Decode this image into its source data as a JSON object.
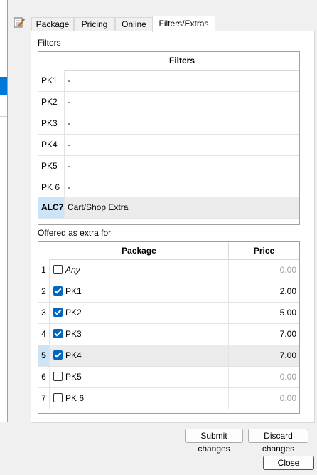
{
  "tabs": [
    "Package",
    "Pricing",
    "Online",
    "Filters/Extras"
  ],
  "active_tab": "Filters/Extras",
  "filters_section_label": "Filters",
  "filters_table": {
    "header": "Filters",
    "rows": [
      {
        "key": "PK1",
        "value": "-"
      },
      {
        "key": "PK2",
        "value": "-"
      },
      {
        "key": "PK3",
        "value": "-"
      },
      {
        "key": "PK4",
        "value": "-"
      },
      {
        "key": "PK5",
        "value": "-"
      },
      {
        "key": "PK 6",
        "value": "-"
      },
      {
        "key": "ALC7",
        "value": "Cart/Shop Extra"
      }
    ]
  },
  "offered_section_label": "Offered as extra for",
  "package_table": {
    "header_package": "Package",
    "header_price": "Price",
    "rows": [
      {
        "num": "1",
        "name": "Any",
        "checked": false,
        "price": "0.00"
      },
      {
        "num": "2",
        "name": "PK1",
        "checked": true,
        "price": "2.00"
      },
      {
        "num": "3",
        "name": "PK2",
        "checked": true,
        "price": "5.00"
      },
      {
        "num": "4",
        "name": "PK3",
        "checked": true,
        "price": "7.00"
      },
      {
        "num": "5",
        "name": "PK4",
        "checked": true,
        "price": "7.00"
      },
      {
        "num": "6",
        "name": "PK5",
        "checked": false,
        "price": "0.00"
      },
      {
        "num": "7",
        "name": "PK 6",
        "checked": false,
        "price": "0.00"
      }
    ]
  },
  "buttons": {
    "submit": "Submit changes",
    "discard": "Discard changes",
    "close": "Close"
  }
}
